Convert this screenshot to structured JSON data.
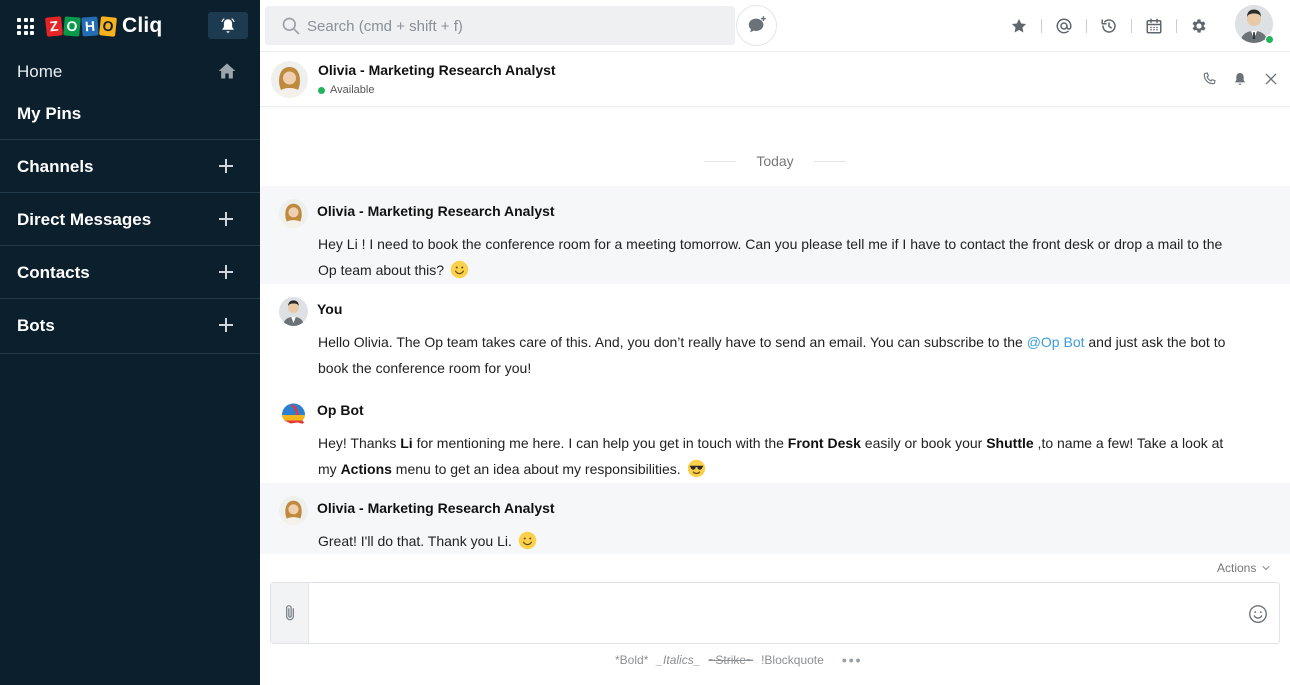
{
  "app": {
    "brand_letters": [
      "Z",
      "O",
      "H",
      "O"
    ],
    "brand_name": "Cliq",
    "colors": {
      "sidebar_bg": "#0c1f2c",
      "accent_blue": "#3b9dd8",
      "online_green": "#23b35d"
    }
  },
  "sidebar": {
    "home_label": "Home",
    "items": [
      {
        "label": "My Pins"
      },
      {
        "label": "Channels"
      },
      {
        "label": "Direct Messages"
      },
      {
        "label": "Contacts"
      },
      {
        "label": "Bots"
      }
    ]
  },
  "topbar": {
    "search_placeholder": "Search (cmd + shift + f)",
    "icons": [
      "star-icon",
      "mention-icon",
      "history-icon",
      "calendar-icon",
      "gear-icon"
    ]
  },
  "chat": {
    "title": "Olivia - Marketing Research Analyst",
    "status": "Available",
    "day_separator": "Today",
    "messages": [
      {
        "sender": "Olivia - Marketing Research Analyst",
        "text_1": "Hey Li ! I need to book the conference room for a meeting tomorrow.  Can you please tell me if I have to contact the front desk or drop a mail to the Op team about this?",
        "emoji": "smile-emoji"
      },
      {
        "sender": "You",
        "text_1": "Hello Olivia. The Op team takes care of this. And, you don’t really have to send an email. You can subscribe to the",
        "mention": "@Op Bot",
        "text_2": " and just ask the bot to book the conference room for you!"
      },
      {
        "sender": "Op Bot",
        "text_1": "Hey! Thanks ",
        "bold_1": "Li",
        "text_2": " for mentioning me here. I can help you get in touch with the ",
        "bold_2": "Front Desk",
        "text_3": " easily or book your ",
        "bold_3": "Shuttle",
        "text_4": " ,to name a few! Take a look at my ",
        "bold_4": "Actions",
        "text_5": " menu to get an idea about my responsibilities.",
        "emoji": "sunglasses-emoji"
      },
      {
        "sender": "Olivia - Marketing Research Analyst",
        "text_1": "Great! I'll do that. Thank you Li.",
        "emoji": "smile-emoji"
      }
    ]
  },
  "composer": {
    "actions_label": "Actions",
    "format_bold": "*Bold*",
    "format_italics": "_Italics_",
    "format_strike": "~Strike~",
    "format_blockquote": "!Blockquote",
    "more": "•••"
  }
}
